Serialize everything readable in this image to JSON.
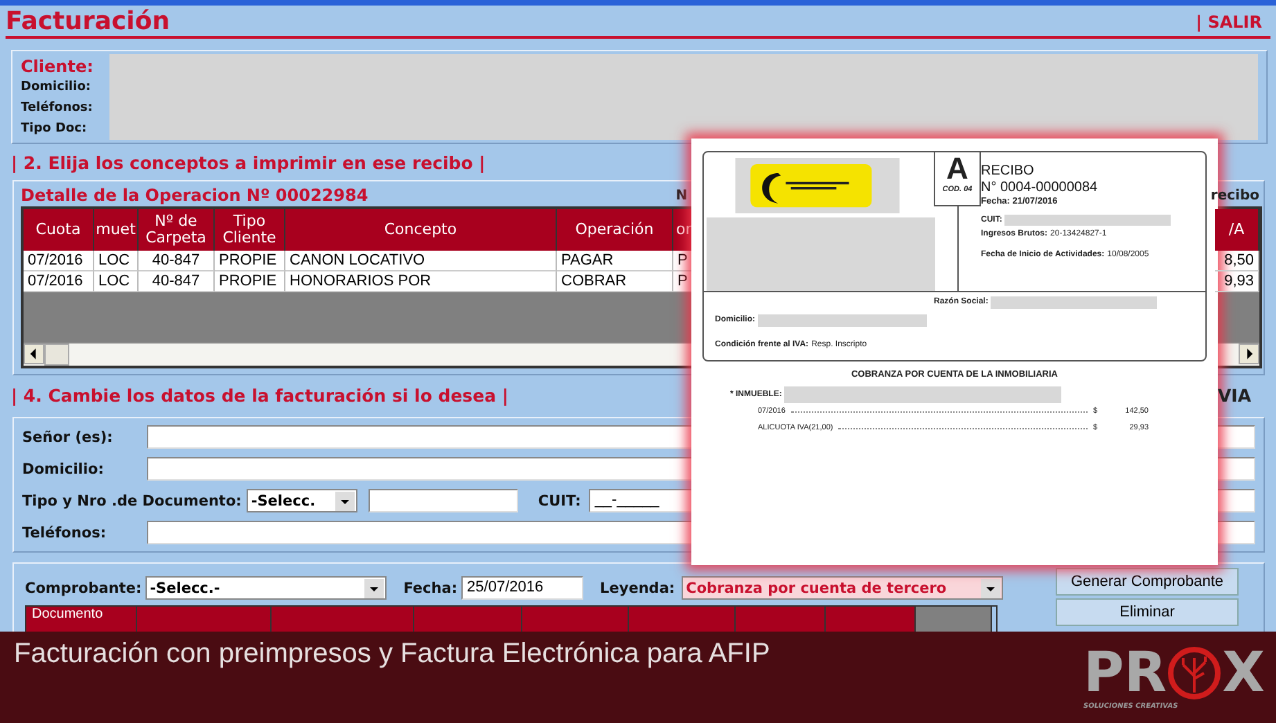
{
  "window": {
    "title": "Facturación",
    "exit": "| SALIR"
  },
  "client": {
    "labels": [
      "Cliente:",
      "Domicilio:",
      "Teléfonos:",
      "Tipo Doc:"
    ]
  },
  "section2": {
    "heading": "| 2. Elija los conceptos a imprimir en ese recibo |"
  },
  "operation": {
    "title": "Detalle de la Operacion Nº 00022984",
    "note_left": "N",
    "note_right": "recibo",
    "columns": [
      "Cuota",
      "muet",
      "Nº de Carpeta",
      "Tipo Cliente",
      "Concepto",
      "Operación",
      "or",
      "/A"
    ],
    "rows": [
      {
        "cells": [
          "07/2016",
          "LOC",
          "40-847",
          "PROPIE",
          "CANON LOCATIVO",
          "PAGAR",
          "P",
          "8,50"
        ]
      },
      {
        "cells": [
          "07/2016",
          "LOC",
          "40-847",
          "PROPIE",
          "HONORARIOS POR",
          "COBRAR",
          "P",
          "9,93"
        ]
      }
    ]
  },
  "section4": {
    "heading": "| 4. Cambie los datos de la facturación si lo desea |",
    "right": "VIA"
  },
  "form": {
    "senor": "Señor (es):",
    "domicilio": "Domicilio:",
    "doc": "Tipo y Nro .de Documento:",
    "doc_select": "-Selecc.",
    "cuit": "CUIT:",
    "cuit_value": "__-_____",
    "telefonos": "Teléfonos:"
  },
  "comprobante": {
    "label": "Comprobante:",
    "select": "-Selecc.-",
    "fecha_label": "Fecha:",
    "fecha": "25/07/2016",
    "leyenda_label": "Leyenda:",
    "leyenda": "Cobranza por cuenta de tercero",
    "first_column": "Documento"
  },
  "buttons": [
    "Generar Comprobante",
    "Eliminar"
  ],
  "receipt": {
    "letter": "A",
    "code": "COD. 04",
    "title": "RECIBO",
    "number": "N° 0004-00000084",
    "date": "Fecha: 21/07/2016",
    "cuit": "CUIT:",
    "ib_label": "Ingresos Brutos:",
    "ib": "20-13424827-1",
    "start_label": "Fecha de Inicio de Actividades:",
    "start": "10/08/2005",
    "razon": "Razón Social:",
    "domicilio": "Domicilio:",
    "iva_label": "Condición frente al IVA:",
    "iva": "Resp. Inscripto",
    "heading": "COBRANZA POR CUENTA DE LA INMOBILIARIA",
    "inmueble": "* INMUEBLE:",
    "lines": [
      {
        "label": "07/2016",
        "currency": "$",
        "amount": "142,50"
      },
      {
        "label": "ALICUOTA IVA(21,00)",
        "currency": "$",
        "amount": "29,93"
      }
    ]
  },
  "banner": {
    "caption": "Facturación con preimpresos y Factura Electrónica para AFIP",
    "brand_left": "PR",
    "brand_right": "X",
    "tagline": "SOLUCIONES CREATIVAS"
  }
}
